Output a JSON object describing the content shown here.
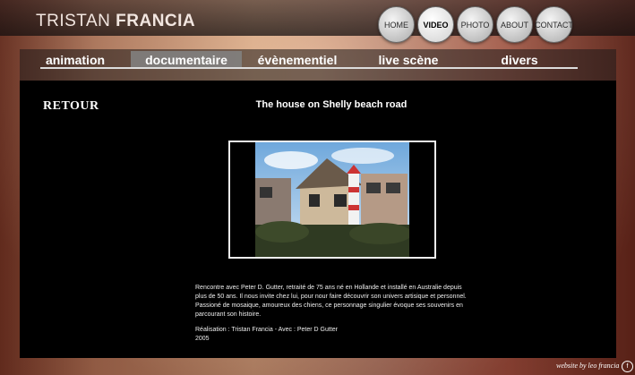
{
  "site": {
    "first_name": "TRISTAN",
    "last_name": "FRANCIA"
  },
  "nav": [
    {
      "label": "HOME",
      "active": false
    },
    {
      "label": "VIDEO",
      "active": true
    },
    {
      "label": "PHOTO",
      "active": false
    },
    {
      "label": "ABOUT",
      "active": false
    },
    {
      "label": "CONTACT",
      "active": false
    }
  ],
  "tabs": [
    {
      "label": "animation",
      "active": false
    },
    {
      "label": "documentaire",
      "active": true
    },
    {
      "label": "évènementiel",
      "active": false
    },
    {
      "label": "live scène",
      "active": false
    },
    {
      "label": "divers",
      "active": false
    }
  ],
  "content": {
    "back_label": "RETOUR",
    "video_title": "The house on Shelly beach road",
    "description": "Rencontre avec Peter D. Gutter, retraité de 75 ans né en Hollande et installé en Australie depuis plus de 50 ans. Il nous invite chez lui, pour nour faire découvrir son univers artisique et personnel. Passioné de mosaique, amoureux des chiens, ce personnage singulier évoque ses souvenirs en parcourant son histoire.",
    "credits": "Réalisation : Tristan Francia - Avec : Peter D Gutter",
    "year": "2005"
  },
  "footer": {
    "credit": "website by leo francia",
    "icon": "f"
  }
}
